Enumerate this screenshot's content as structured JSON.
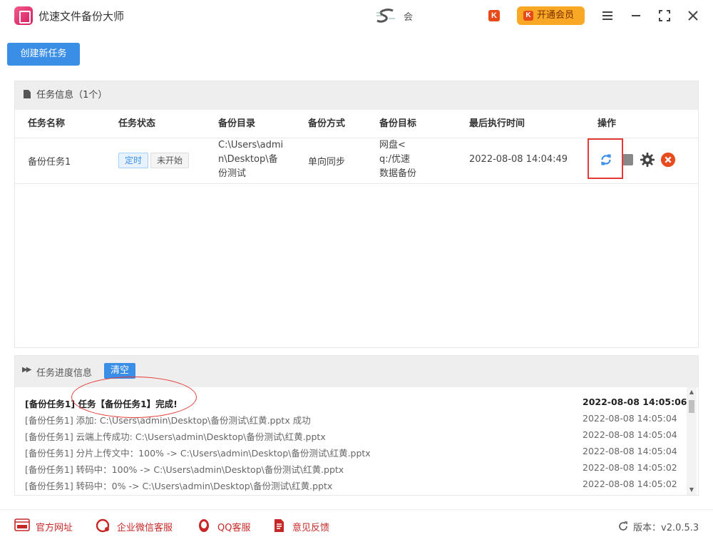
{
  "app": {
    "title": "优速文件备份大师",
    "user_name": "会",
    "user_badge": "K",
    "vip_button": "开通会员",
    "vip_icon": "K"
  },
  "toolbar": {
    "new_task": "创建新任务"
  },
  "task_panel": {
    "title": "任务信息（1个）",
    "columns": [
      "任务名称",
      "任务状态",
      "备份目录",
      "备份方式",
      "备份目标",
      "最后执行时间",
      "操作"
    ],
    "rows": [
      {
        "name": "备份任务1",
        "status_tags": [
          "定时",
          "未开始"
        ],
        "source_dir": "C:\\Users\\admi\nn\\Desktop\\备\n份测试",
        "mode": "单向同步",
        "target": "网盘<\nq:/优速\n数据备份",
        "last_run": "2022-08-08 14:04:49"
      }
    ]
  },
  "progress_panel": {
    "title": "任务进度信息",
    "clear_button": "清空",
    "logs": [
      {
        "text": "[备份任务1] 任务【备份任务1】完成!",
        "time": "2022-08-08 14:05:06",
        "bold": true
      },
      {
        "text": "[备份任务1] 添加:   C:\\Users\\admin\\Desktop\\备份测试\\红黄.pptx 成功",
        "time": "2022-08-08 14:05:04"
      },
      {
        "text": "[备份任务1] 云端上传成功: C:\\Users\\admin\\Desktop\\备份测试\\红黄.pptx",
        "time": "2022-08-08 14:05:04"
      },
      {
        "text": "[备份任务1] 分片上传文中：100% -> C:\\Users\\admin\\Desktop\\备份测试\\红黄.pptx",
        "time": "2022-08-08 14:05:04"
      },
      {
        "text": "[备份任务1] 转码中：100% -> C:\\Users\\admin\\Desktop\\备份测试\\红黄.pptx",
        "time": "2022-08-08 14:05:02"
      },
      {
        "text": "[备份任务1] 转码中：0% -> C:\\Users\\admin\\Desktop\\备份测试\\红黄.pptx",
        "time": "2022-08-08 14:05:02"
      }
    ]
  },
  "footer": {
    "links": [
      "官方网址",
      "企业微信客服",
      "QQ客服",
      "意见反馈"
    ],
    "version": "版本：v2.0.5.3"
  },
  "colors": {
    "accent": "#3a8ee6",
    "vip": "#f9a825",
    "danger": "#e53935",
    "footer_link": "#c62828"
  }
}
